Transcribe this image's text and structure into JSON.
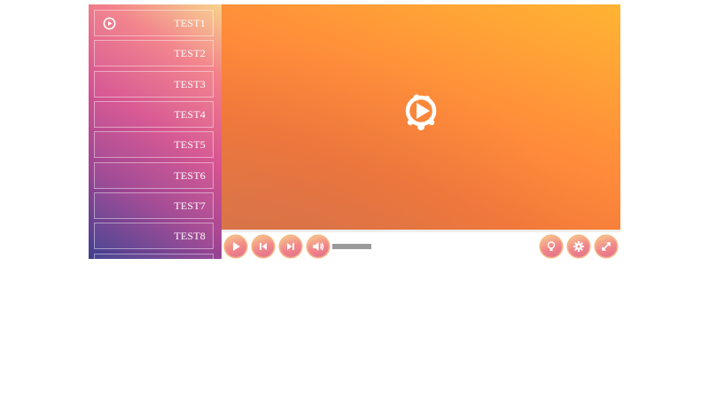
{
  "playlist": {
    "items": [
      {
        "label": "TEST1",
        "active": true
      },
      {
        "label": "TEST2",
        "active": false
      },
      {
        "label": "TEST3",
        "active": false
      },
      {
        "label": "TEST4",
        "active": false
      },
      {
        "label": "TEST5",
        "active": false
      },
      {
        "label": "TEST6",
        "active": false
      },
      {
        "label": "TEST7",
        "active": false
      },
      {
        "label": "TEST8",
        "active": false
      }
    ]
  },
  "video": {
    "logo_icon": "play-logo-icon"
  },
  "controls": {
    "buttons": [
      {
        "name": "play-button",
        "icon": "play-icon"
      },
      {
        "name": "previous-button",
        "icon": "skip-back-icon"
      },
      {
        "name": "next-button",
        "icon": "skip-forward-icon"
      },
      {
        "name": "volume-button",
        "icon": "volume-icon"
      },
      {
        "name": "light-button",
        "icon": "lightbulb-icon"
      },
      {
        "name": "settings-button",
        "icon": "gear-icon"
      },
      {
        "name": "fullscreen-button",
        "icon": "expand-icon"
      }
    ],
    "volume_level": 1.0
  },
  "colors": {
    "accent_orange": "#ff8c3a",
    "accent_pink": "#f2868a",
    "sidebar_top": "#f7d38c",
    "sidebar_bottom": "#3f3f90"
  }
}
